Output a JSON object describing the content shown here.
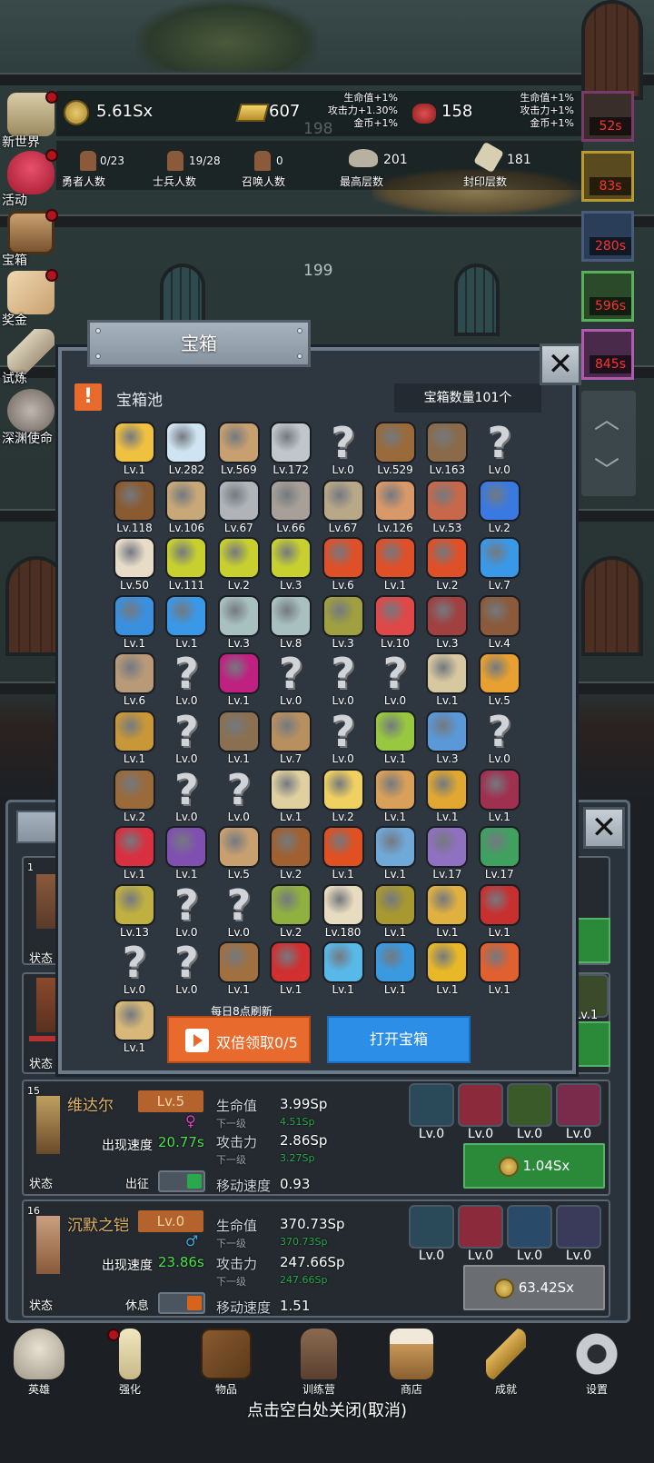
{
  "sidebar": [
    {
      "label": "新世界",
      "dot": true
    },
    {
      "label": "活动",
      "dot": true
    },
    {
      "label": "宝箱",
      "dot": true
    },
    {
      "label": "奖金",
      "dot": true
    },
    {
      "label": "试炼",
      "dot": false
    },
    {
      "label": "深渊使命",
      "dot": false
    }
  ],
  "resources": {
    "gold": "5.61Sx",
    "bars": "607",
    "meat": "158",
    "floor_a": "198",
    "floor_b": "199",
    "buff_left": [
      "生命值+1%",
      "攻击力+1.30%",
      "金币+1%"
    ],
    "buff_right": [
      "生命值+1%",
      "攻击力+1%",
      "金币+1%"
    ]
  },
  "counts": [
    {
      "value": "0/23",
      "label": "勇者人数"
    },
    {
      "value": "19/28",
      "label": "士兵人数"
    },
    {
      "value": "0",
      "label": "召唤人数"
    },
    {
      "value": "201",
      "label": "最高层数"
    },
    {
      "value": "181",
      "label": "封印层数"
    }
  ],
  "timers": [
    "52s",
    "83s",
    "280s",
    "596s",
    "845s"
  ],
  "chest": {
    "title": "宝箱",
    "pool_label": "宝箱池",
    "count_text": "宝箱数量101个",
    "refresh_note": "每日8点刷新",
    "double_btn": "双倍领取0/5",
    "open_btn": "打开宝箱",
    "items": [
      {
        "lv": "Lv.1",
        "icon": "crown-icon"
      },
      {
        "lv": "Lv.282",
        "icon": "diamond-icon"
      },
      {
        "lv": "Lv.569",
        "icon": "wooden-sword-icon"
      },
      {
        "lv": "Lv.172",
        "icon": "sword-icon"
      },
      {
        "lv": "Lv.0",
        "icon": "unknown-icon"
      },
      {
        "lv": "Lv.529",
        "icon": "leather-armor-icon"
      },
      {
        "lv": "Lv.163",
        "icon": "backpack-icon"
      },
      {
        "lv": "Lv.0",
        "icon": "unknown-icon"
      },
      {
        "lv": "Lv.118",
        "icon": "leather-helmet-icon"
      },
      {
        "lv": "Lv.106",
        "icon": "dagger-icon"
      },
      {
        "lv": "Lv.67",
        "icon": "knight-helmet-icon"
      },
      {
        "lv": "Lv.66",
        "icon": "hammer-icon"
      },
      {
        "lv": "Lv.67",
        "icon": "great-helm-icon"
      },
      {
        "lv": "Lv.126",
        "icon": "ham-icon"
      },
      {
        "lv": "Lv.53",
        "icon": "steak-icon"
      },
      {
        "lv": "Lv.2",
        "icon": "blue-pouch-icon"
      },
      {
        "lv": "Lv.50",
        "icon": "flour-bowl-icon"
      },
      {
        "lv": "Lv.111",
        "icon": "yellow-potion-icon"
      },
      {
        "lv": "Lv.2",
        "icon": "yellow-potion-icon"
      },
      {
        "lv": "Lv.3",
        "icon": "yellow-potion-icon"
      },
      {
        "lv": "Lv.6",
        "icon": "red-potion-icon"
      },
      {
        "lv": "Lv.1",
        "icon": "red-potion-icon"
      },
      {
        "lv": "Lv.2",
        "icon": "red-potion-icon"
      },
      {
        "lv": "Lv.7",
        "icon": "blue-potion-icon"
      },
      {
        "lv": "Lv.1",
        "icon": "blue-jar-icon"
      },
      {
        "lv": "Lv.1",
        "icon": "blue-potion-icon"
      },
      {
        "lv": "Lv.3",
        "icon": "empty-bottle-icon"
      },
      {
        "lv": "Lv.8",
        "icon": "empty-bottle-icon"
      },
      {
        "lv": "Lv.3",
        "icon": "yellow-bottle-icon"
      },
      {
        "lv": "Lv.10",
        "icon": "red-bottle-icon"
      },
      {
        "lv": "Lv.3",
        "icon": "winged-boot-icon"
      },
      {
        "lv": "Lv.4",
        "icon": "leather-boot-icon"
      },
      {
        "lv": "Lv.6",
        "icon": "cloth-boot-icon"
      },
      {
        "lv": "Lv.0",
        "icon": "unknown-icon"
      },
      {
        "lv": "Lv.1",
        "icon": "magenta-boots-icon"
      },
      {
        "lv": "Lv.0",
        "icon": "unknown-icon"
      },
      {
        "lv": "Lv.0",
        "icon": "unknown-icon"
      },
      {
        "lv": "Lv.0",
        "icon": "unknown-icon"
      },
      {
        "lv": "Lv.1",
        "icon": "short-sword-icon"
      },
      {
        "lv": "Lv.5",
        "icon": "torch-icon"
      },
      {
        "lv": "Lv.1",
        "icon": "golden-staff-icon"
      },
      {
        "lv": "Lv.0",
        "icon": "unknown-icon"
      },
      {
        "lv": "Lv.1",
        "icon": "pickaxe-icon"
      },
      {
        "lv": "Lv.7",
        "icon": "crook-staff-icon"
      },
      {
        "lv": "Lv.0",
        "icon": "unknown-icon"
      },
      {
        "lv": "Lv.1",
        "icon": "lime-icon"
      },
      {
        "lv": "Lv.3",
        "icon": "blue-wand-icon"
      },
      {
        "lv": "Lv.0",
        "icon": "unknown-icon"
      },
      {
        "lv": "Lv.2",
        "icon": "travel-pack-icon"
      },
      {
        "lv": "Lv.0",
        "icon": "unknown-icon"
      },
      {
        "lv": "Lv.0",
        "icon": "unknown-icon"
      },
      {
        "lv": "Lv.1",
        "icon": "bone-club-icon"
      },
      {
        "lv": "Lv.2",
        "icon": "cheese-icon"
      },
      {
        "lv": "Lv.1",
        "icon": "pie-icon"
      },
      {
        "lv": "Lv.1",
        "icon": "honey-jar-icon"
      },
      {
        "lv": "Lv.1",
        "icon": "dark-crystal-icon"
      },
      {
        "lv": "Lv.1",
        "icon": "red-orb-icon"
      },
      {
        "lv": "Lv.1",
        "icon": "rainbow-gem-icon"
      },
      {
        "lv": "Lv.5",
        "icon": "bow-icon"
      },
      {
        "lv": "Lv.2",
        "icon": "quiver-icon"
      },
      {
        "lv": "Lv.1",
        "icon": "fire-gauntlet-icon"
      },
      {
        "lv": "Lv.1",
        "icon": "frost-gauntlet-icon"
      },
      {
        "lv": "Lv.17",
        "icon": "spirit-gauntlet-icon"
      },
      {
        "lv": "Lv.17",
        "icon": "emerald-amulet-icon"
      },
      {
        "lv": "Lv.13",
        "icon": "vial-icon"
      },
      {
        "lv": "Lv.0",
        "icon": "unknown-icon"
      },
      {
        "lv": "Lv.0",
        "icon": "unknown-icon"
      },
      {
        "lv": "Lv.2",
        "icon": "green-wand-icon"
      },
      {
        "lv": "Lv.180",
        "icon": "beer-icon"
      },
      {
        "lv": "Lv.1",
        "icon": "vine-icon"
      },
      {
        "lv": "Lv.1",
        "icon": "golden-pickaxe-icon"
      },
      {
        "lv": "Lv.1",
        "icon": "red-tome-icon"
      },
      {
        "lv": "Lv.0",
        "icon": "unknown-icon"
      },
      {
        "lv": "Lv.0",
        "icon": "unknown-icon"
      },
      {
        "lv": "Lv.1",
        "icon": "whip-icon"
      },
      {
        "lv": "Lv.1",
        "icon": "monster-card-icon"
      },
      {
        "lv": "Lv.1",
        "icon": "crystal-ball-icon"
      },
      {
        "lv": "Lv.1",
        "icon": "rune-orb-icon"
      },
      {
        "lv": "Lv.1",
        "icon": "golden-orb-icon"
      },
      {
        "lv": "Lv.1",
        "icon": "fire-rod-icon"
      },
      {
        "lv": "Lv.1",
        "icon": "golden-shield-icon"
      }
    ]
  },
  "hero_list": {
    "partial": [
      {
        "rank": "1",
        "status": "状态"
      },
      {
        "status": "状态"
      }
    ],
    "heroes": [
      {
        "rank": "15",
        "name": "维达尔",
        "level": "Lv.5",
        "gender": "♀",
        "speed_label": "出现速度",
        "speed": "20.77s",
        "hp_label": "生命值",
        "hp": "3.99Sp",
        "hp_next_label": "下一级",
        "hp_next": "4.51Sp",
        "atk_label": "攻击力",
        "atk": "2.86Sp",
        "atk_next_label": "下一级",
        "atk_next": "3.27Sp",
        "move_label": "移动速度",
        "move": "0.93",
        "status_label": "状态",
        "status": "出征",
        "skills": [
          "Lv.0",
          "Lv.0",
          "Lv.0",
          "Lv.0"
        ],
        "cost": "1.04Sx"
      },
      {
        "rank": "16",
        "name": "沉默之铠",
        "level": "Lv.0",
        "gender": "♂",
        "speed_label": "出现速度",
        "speed": "23.86s",
        "hp_label": "生命值",
        "hp": "370.73Sp",
        "hp_next_label": "下一级",
        "hp_next": "370.73Sp",
        "atk_label": "攻击力",
        "atk": "247.66Sp",
        "atk_next_label": "下一级",
        "atk_next": "247.66Sp",
        "move_label": "移动速度",
        "move": "1.51",
        "status_label": "状态",
        "status": "休息",
        "skills": [
          "Lv.0",
          "Lv.0",
          "Lv.0",
          "Lv.0"
        ],
        "cost": "63.42Sx"
      }
    ],
    "skill_lv_partial": [
      "Lv.1",
      "Lv.1"
    ]
  },
  "bottom_nav": [
    {
      "label": "英雄",
      "icon": "skull-icon"
    },
    {
      "label": "强化",
      "icon": "candle-icon"
    },
    {
      "label": "物品",
      "icon": "book-icon"
    },
    {
      "label": "训练营",
      "icon": "lantern-icon"
    },
    {
      "label": "商店",
      "icon": "beer-mug-icon"
    },
    {
      "label": "成就",
      "icon": "key-icon"
    },
    {
      "label": "设置",
      "icon": "gear-icon"
    }
  ],
  "close_hint": "点击空白处关闭(取消)",
  "colors": {
    "accent_orange": "#e86a2c",
    "accent_blue": "#2d8ee8",
    "green": "#2a8a3a",
    "timer_red": "#ff3030"
  }
}
